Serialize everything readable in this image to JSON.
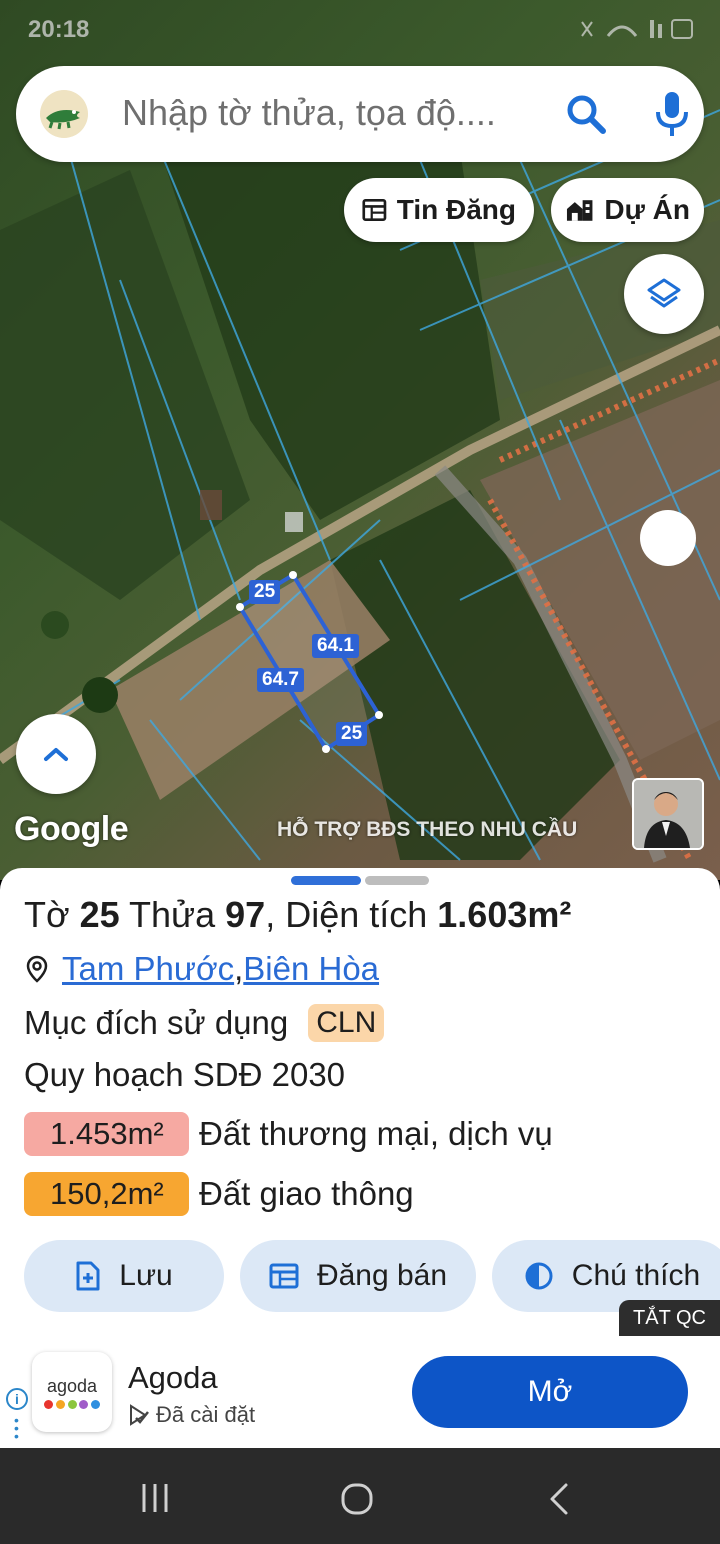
{
  "status_bar": {
    "time": "20:18"
  },
  "search": {
    "placeholder": "Nhập tờ thửa, tọa độ...."
  },
  "chips": {
    "tin_dang": "Tin Đăng",
    "du_an": "Dự Án"
  },
  "map": {
    "dimensions": {
      "top": "25",
      "right": "64.1",
      "left": "64.7",
      "bottom": "25"
    },
    "google_logo": "Google",
    "support_text": "HỖ TRỢ BĐS THEO NHU CẦU"
  },
  "parcel": {
    "title_prefix": "Tờ ",
    "sheet_no": "25",
    "title_mid": " Thửa ",
    "parcel_no": "97",
    "title_area_prefix": ", Diện tích ",
    "area": "1.603m²",
    "ward": "Tam Phước",
    "separator": ", ",
    "city": "Biên Hòa",
    "purpose_label": "Mục đích sử dụng",
    "purpose_code": "CLN",
    "plan_label": "Quy hoạch SDĐ 2030",
    "plan_items": [
      {
        "area": "1.453m²",
        "desc": "Đất thương mại, dịch vụ",
        "color": "#f6a9a2"
      },
      {
        "area": "150,2m²",
        "desc": "Đất giao thông",
        "color": "#f7a631"
      }
    ]
  },
  "actions": {
    "save": "Lưu",
    "post_sale": "Đăng bán",
    "legend": "Chú thích"
  },
  "ad": {
    "close_label": "TẮT QC",
    "logo_text": "agoda",
    "app_name": "Agoda",
    "installed_label": "Đã cài đặt",
    "open_label": "Mở"
  },
  "colors": {
    "accent": "#2f6fd8",
    "button_bg": "#dce8f6",
    "ad_button": "#0d55c7"
  }
}
